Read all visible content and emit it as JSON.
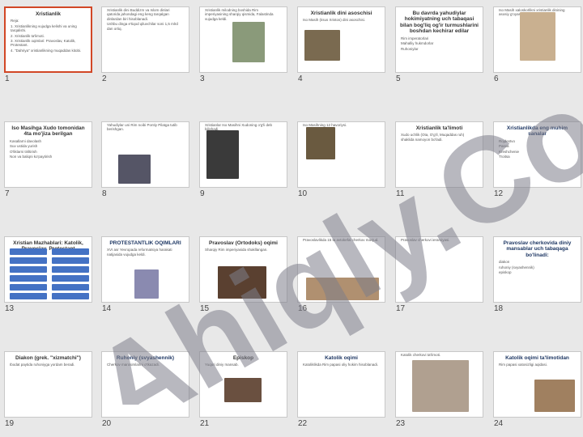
{
  "slides": [
    {
      "num": "1",
      "title": "Xristianlik",
      "bullets": [
        "Reja:",
        "1. Xristianlikning vujudga kelishi va uning tarqalishi.",
        "2. Xristianlik ta'limoti.",
        "3. Xristianlik oqimlari: Pravoslav, Katolik, Protestant.",
        "4. \"Dahriya\" xristianlikning muqaddas kitobi."
      ]
    },
    {
      "num": "2",
      "title": "",
      "bullets": [
        "Xristianlik dini Buddizm va Islom dinlari qatorida jahondagi eng keng tarqalgan dinlardan biri hisoblanadi.",
        "Ushbu dinga e'tiqod qiluvchilar soni 1,5 mlrd dan ortiq."
      ]
    },
    {
      "num": "3",
      "title": "",
      "bullets": [
        "Xristianlik milodning boshida Rim imperiyasining sharqiy qismida, Falastinda vujudga keldi."
      ]
    },
    {
      "num": "4",
      "title": "Xristianlik dini asoschisi",
      "bullets": [
        "Iso Masih (Iisus Xristos) dini asoschisi."
      ]
    },
    {
      "num": "5",
      "title": "Bu davrda yahudiylar hokimiyatning uch tabaqasi bilan bog'liq og'ir turmushlarini boshdan kechirar edilar",
      "bullets": [
        "Rim imperatorlari",
        "Mahalliy hukmdorlar",
        "Ruhoniylar"
      ]
    },
    {
      "num": "6",
      "title": "",
      "bullets": [
        "Iso Masih xaloskorlikni xristianlik dinining asosiy g'oyasi qildi."
      ]
    },
    {
      "num": "7",
      "title": "Iso Masihga Xudo tomonidan 4ta mo'jiza berilgan",
      "bullets": [
        "Kasallarni davolash",
        "Suv ustida yurish",
        "O'liklarni tiriltirish",
        "Non va baliqni ko'paytirish"
      ]
    },
    {
      "num": "8",
      "title": "",
      "bullets": [
        "Yahudiylar uni Rim noibi Pontiy Pilatga tutib berishgan."
      ]
    },
    {
      "num": "9",
      "title": "",
      "bullets": [
        "Xristianlar Iso Masihni Xudoning o'g'li deb bilishadi."
      ]
    },
    {
      "num": "10",
      "title": "",
      "bullets": [
        "Iso Masihning 12 havoriysi."
      ]
    },
    {
      "num": "11",
      "title": "Xristianlik ta'limoti",
      "bullets": [
        "Xudo uchlik (Ota, O'g'il, Muqaddas ruh) shaklida namoyon bo'ladi."
      ]
    },
    {
      "num": "12",
      "title": "Xristianlikda eng muhim sanalar",
      "bullets": [
        "Rojdestvo",
        "Pasxa",
        "Kreshchenie",
        "Troitsa"
      ]
    },
    {
      "num": "13",
      "title": "Xristian Mazhablari: Katolik, Pravoslav, Protestant",
      "bullets": []
    },
    {
      "num": "14",
      "title": "PROTESTANTLIK OQIMLARI",
      "bullets": [
        "XVI asr Yevropada reformatsiya harakati natijasida vujudga keldi."
      ]
    },
    {
      "num": "15",
      "title": "Pravoslav (Ortodoks) oqimi",
      "bullets": [
        "Sharqiy Rim imperiyasida shakllangan."
      ]
    },
    {
      "num": "16",
      "title": "",
      "bullets": [
        "Pravoslavlikda 15 ta avtokefal cherkov mavjud."
      ]
    },
    {
      "num": "17",
      "title": "",
      "bullets": [
        "Pravoslav cherkovi ierarxiyasi."
      ]
    },
    {
      "num": "18",
      "title": "Pravoslav cherkovida diniy mansablar uch tabaqaga bo'linadi:",
      "bullets": [
        "diakon",
        "ruhoniy (svyashennik)",
        "episkop"
      ]
    },
    {
      "num": "19",
      "title": "Diakon (grek. \"xizmatchi\")",
      "bullets": [
        "Ibodat paytida ruhoniyga yordam beradi."
      ]
    },
    {
      "num": "20",
      "title": "Ruhoniy (svyashennik)",
      "bullets": [
        "Cherkov marosimlarini o'tkazadi."
      ]
    },
    {
      "num": "21",
      "title": "Episkop",
      "bullets": [
        "Yuqori diniy mansab."
      ]
    },
    {
      "num": "22",
      "title": "Katolik oqimi",
      "bullets": [
        "Katoliklikda Rim papasi oliy hokim hisoblanadi."
      ]
    },
    {
      "num": "23",
      "title": "",
      "bullets": [
        "Katolik cherkovi ta'limoti."
      ]
    },
    {
      "num": "24",
      "title": "Katolik oqimi ta'limotidan",
      "bullets": [
        "Rim papasi xatosizligi aqidasi."
      ]
    }
  ],
  "watermark": {
    "text": "Ahiqly.Co"
  },
  "colors": {
    "selection": "#d24726",
    "watermark": "#7e7e8a",
    "accent": "#4472c4"
  }
}
